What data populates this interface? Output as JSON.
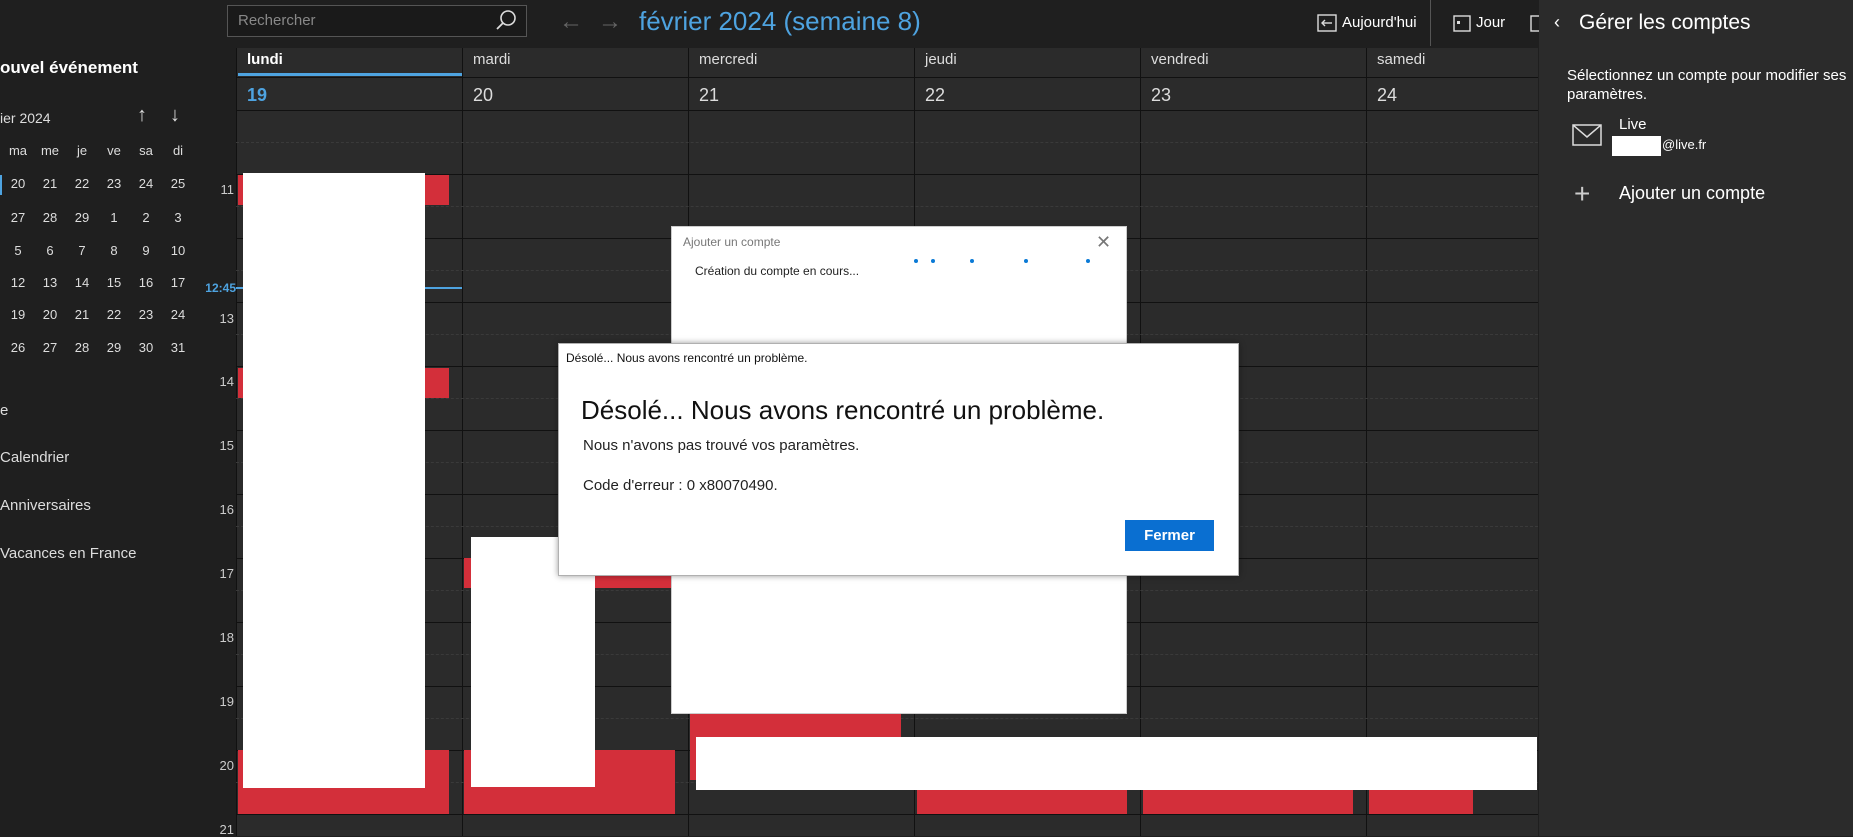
{
  "sidebar": {
    "new_event": "ouvel événement",
    "month_label": "ier 2024",
    "up_arrow": "↑",
    "down_arrow": "↓",
    "weekday_heads": [
      "ma",
      "me",
      "je",
      "ve",
      "sa",
      "di"
    ],
    "weeks": [
      [
        "20",
        "21",
        "22",
        "23",
        "24",
        "25"
      ],
      [
        "27",
        "28",
        "29",
        "1",
        "2",
        "3"
      ],
      [
        "5",
        "6",
        "7",
        "8",
        "9",
        "10"
      ],
      [
        "12",
        "13",
        "14",
        "15",
        "16",
        "17"
      ],
      [
        "19",
        "20",
        "21",
        "22",
        "23",
        "24"
      ],
      [
        "26",
        "27",
        "28",
        "29",
        "30",
        "31"
      ]
    ],
    "section_partial": "e",
    "calendars": [
      "Calendrier",
      "Anniversaires",
      "Vacances en France"
    ]
  },
  "toolbar": {
    "search_placeholder": "Rechercher",
    "back_arrow": "←",
    "fwd_arrow": "→",
    "week_title": "février 2024 (semaine 8)",
    "today_label": "Aujourd'hui",
    "day_label": "Jour"
  },
  "grid": {
    "days": [
      {
        "name": "lundi",
        "num": "19"
      },
      {
        "name": "mardi",
        "num": "20"
      },
      {
        "name": "mercredi",
        "num": "21"
      },
      {
        "name": "jeudi",
        "num": "22"
      },
      {
        "name": "vendredi",
        "num": "23"
      },
      {
        "name": "samedi",
        "num": "24"
      }
    ],
    "hours": [
      "11",
      "13",
      "14",
      "15",
      "16",
      "17",
      "18",
      "19",
      "20",
      "21"
    ],
    "now_label": "12:45"
  },
  "add_account_dialog": {
    "title": "Ajouter un compte",
    "status": "Création du compte en cours...",
    "close_glyph": "✕"
  },
  "error_dialog": {
    "caption": "Désolé... Nous avons rencontré un problème.",
    "heading": "Désolé... Nous avons rencontré un problème.",
    "message": "Nous n'avons pas trouvé vos paramètres.",
    "error_code": "Code d'erreur : 0 x80070490.",
    "close_button": "Fermer"
  },
  "accounts_pane": {
    "back_glyph": "‹",
    "title": "Gérer les comptes",
    "description": "Sélectionnez un compte pour modifier ses paramètres.",
    "account_name": "Live",
    "account_email_suffix": "@live.fr",
    "plus_glyph": "+",
    "add_account": "Ajouter un compte"
  },
  "colors": {
    "accent": "#4ea3e0",
    "event_red": "#d32f3a",
    "primary_button": "#0a6fd1"
  }
}
